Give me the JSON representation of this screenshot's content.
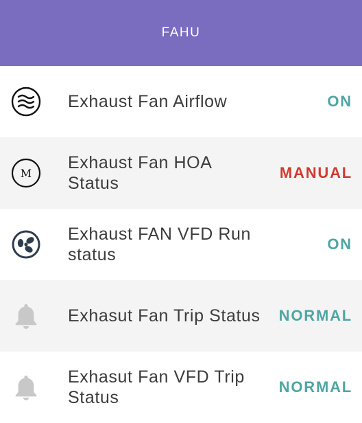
{
  "header": {
    "title": "FAHU",
    "color": "#7a6cbf"
  },
  "rows": [
    {
      "label": "Exhaust Fan Airflow",
      "value": "ON",
      "icon": "airflow-icon",
      "status": "on"
    },
    {
      "label": "Exhaust Fan HOA Status",
      "value": "MANUAL",
      "icon": "manual-mode-icon",
      "status": "manual",
      "icon_letter": "M"
    },
    {
      "label": "Exhaust FAN VFD Run status",
      "value": "ON",
      "icon": "fan-icon",
      "status": "on"
    },
    {
      "label": "Exhasut Fan Trip Status",
      "value": "NORMAL",
      "icon": "bell-icon",
      "status": "normal"
    },
    {
      "label": "Exhasut Fan VFD Trip Status",
      "value": "NORMAL",
      "icon": "bell-icon",
      "status": "normal"
    }
  ],
  "colors": {
    "on": "#4ea6a4",
    "manual": "#d03a2e",
    "normal": "#4ea6a4"
  }
}
